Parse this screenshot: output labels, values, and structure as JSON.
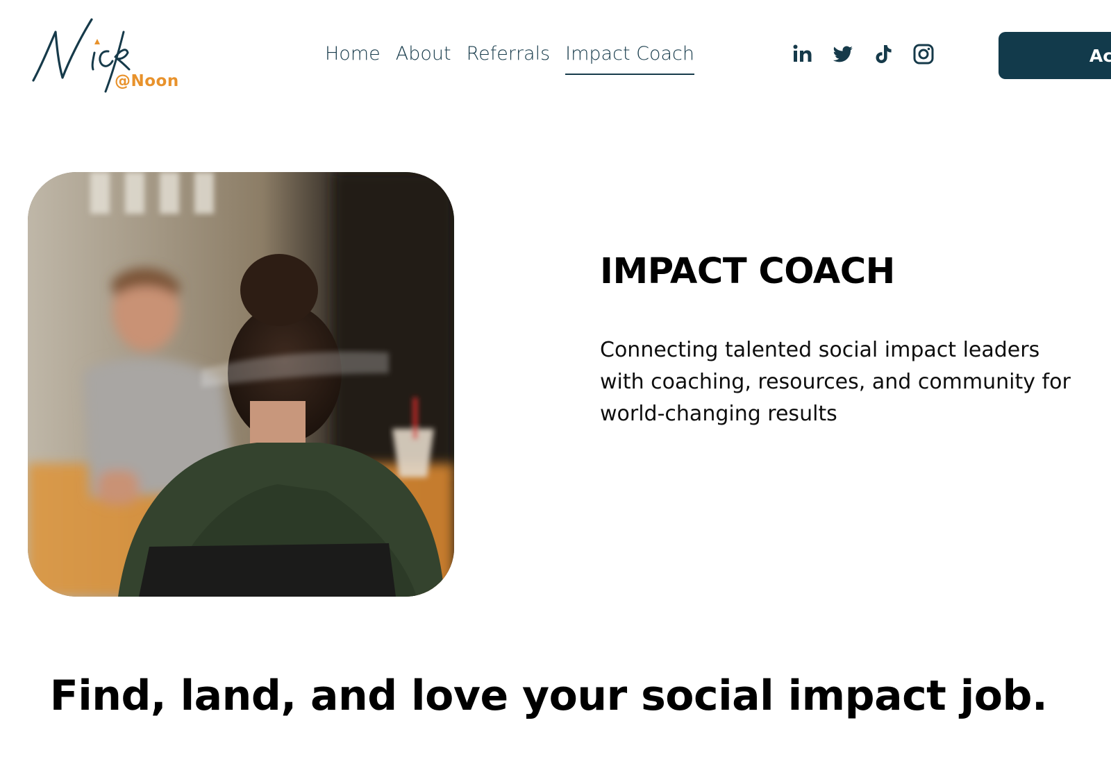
{
  "brand": {
    "logo_script": "Nick",
    "logo_suffix": "@Noon",
    "accent_color": "#e8922c",
    "primary_color": "#123a4b"
  },
  "nav": {
    "items": [
      {
        "label": "Home",
        "active": false
      },
      {
        "label": "About",
        "active": false
      },
      {
        "label": "Referrals",
        "active": false
      },
      {
        "label": "Impact Coach",
        "active": true
      }
    ]
  },
  "social": [
    "linkedin-icon",
    "twitter-icon",
    "tiktok-icon",
    "instagram-icon"
  ],
  "cta": {
    "label": "Ac"
  },
  "hero": {
    "title": "IMPACT COACH",
    "description": "Connecting talented social impact leaders with coaching, resources, and community for world-changing results"
  },
  "tagline": "Find, land, and love your social impact job."
}
